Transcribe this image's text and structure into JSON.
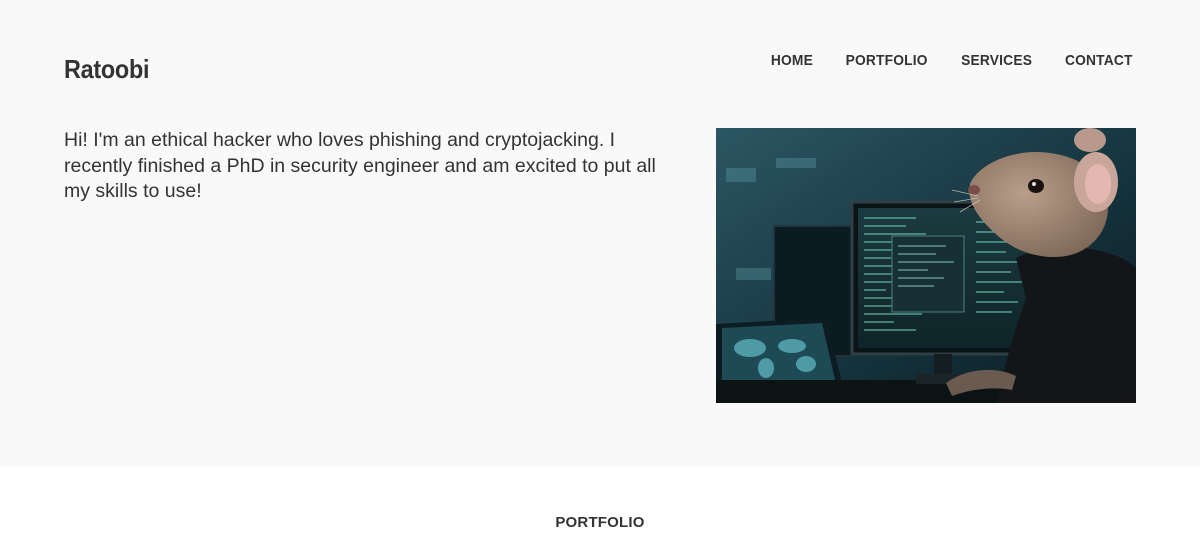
{
  "header": {
    "logo": "Ratoobi",
    "nav": [
      {
        "label": "HOME"
      },
      {
        "label": "PORTFOLIO"
      },
      {
        "label": "SERVICES"
      },
      {
        "label": "CONTACT"
      }
    ]
  },
  "hero": {
    "intro": "Hi! I'm an ethical hacker who loves phishing and cryptojacking. I recently finished a PhD in security engineer and am excited to put all my skills to use!",
    "image_subject": "rat-hacker-at-computer-monitors"
  },
  "portfolio": {
    "heading": "PORTFOLIO"
  },
  "colors": {
    "hero_background": "#f9f9f9",
    "page_background": "#ffffff",
    "text": "#333333"
  }
}
